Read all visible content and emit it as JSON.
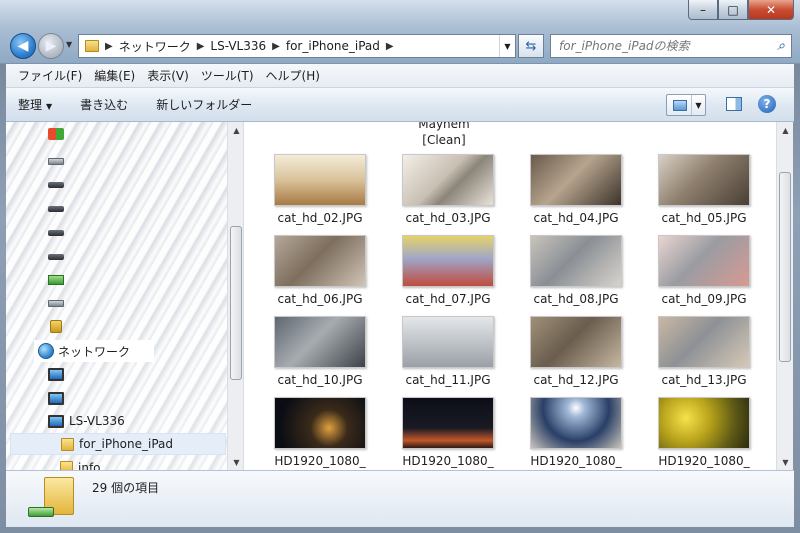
{
  "address": {
    "crumbs": [
      "ネットワーク",
      "LS-VL336",
      "for_iPhone_iPad"
    ]
  },
  "search": {
    "placeholder": "for_iPhone_iPadの検索"
  },
  "menu": [
    "ファイル(F)",
    "編集(E)",
    "表示(V)",
    "ツール(T)",
    "ヘルプ(H)"
  ],
  "toolbar": {
    "organize": "整理",
    "burn": "書き込む",
    "new_folder": "新しいフォルダー"
  },
  "nav": {
    "network": "ネットワーク",
    "server": "LS-VL336",
    "folder": "for_iPhone_iPad",
    "folder2": "info"
  },
  "content": {
    "partial_top_line1": "Mayhem",
    "partial_top_line2": "[Clean]",
    "files": [
      {
        "name": "cat_hd_02.JPG"
      },
      {
        "name": "cat_hd_03.JPG"
      },
      {
        "name": "cat_hd_04.JPG"
      },
      {
        "name": "cat_hd_05.JPG"
      },
      {
        "name": "cat_hd_06.JPG"
      },
      {
        "name": "cat_hd_07.JPG"
      },
      {
        "name": "cat_hd_08.JPG"
      },
      {
        "name": "cat_hd_09.JPG"
      },
      {
        "name": "cat_hd_10.JPG"
      },
      {
        "name": "cat_hd_11.JPG"
      },
      {
        "name": "cat_hd_12.JPG"
      },
      {
        "name": "cat_hd_13.JPG"
      },
      {
        "name": "HD1920_1080_"
      },
      {
        "name": "HD1920_1080_"
      },
      {
        "name": "HD1920_1080_"
      },
      {
        "name": "HD1920_1080_"
      }
    ]
  },
  "details": {
    "count": "29 個の項目"
  },
  "colors": {
    "accent": "#3a6ea5",
    "selected": "#e5eef8"
  }
}
